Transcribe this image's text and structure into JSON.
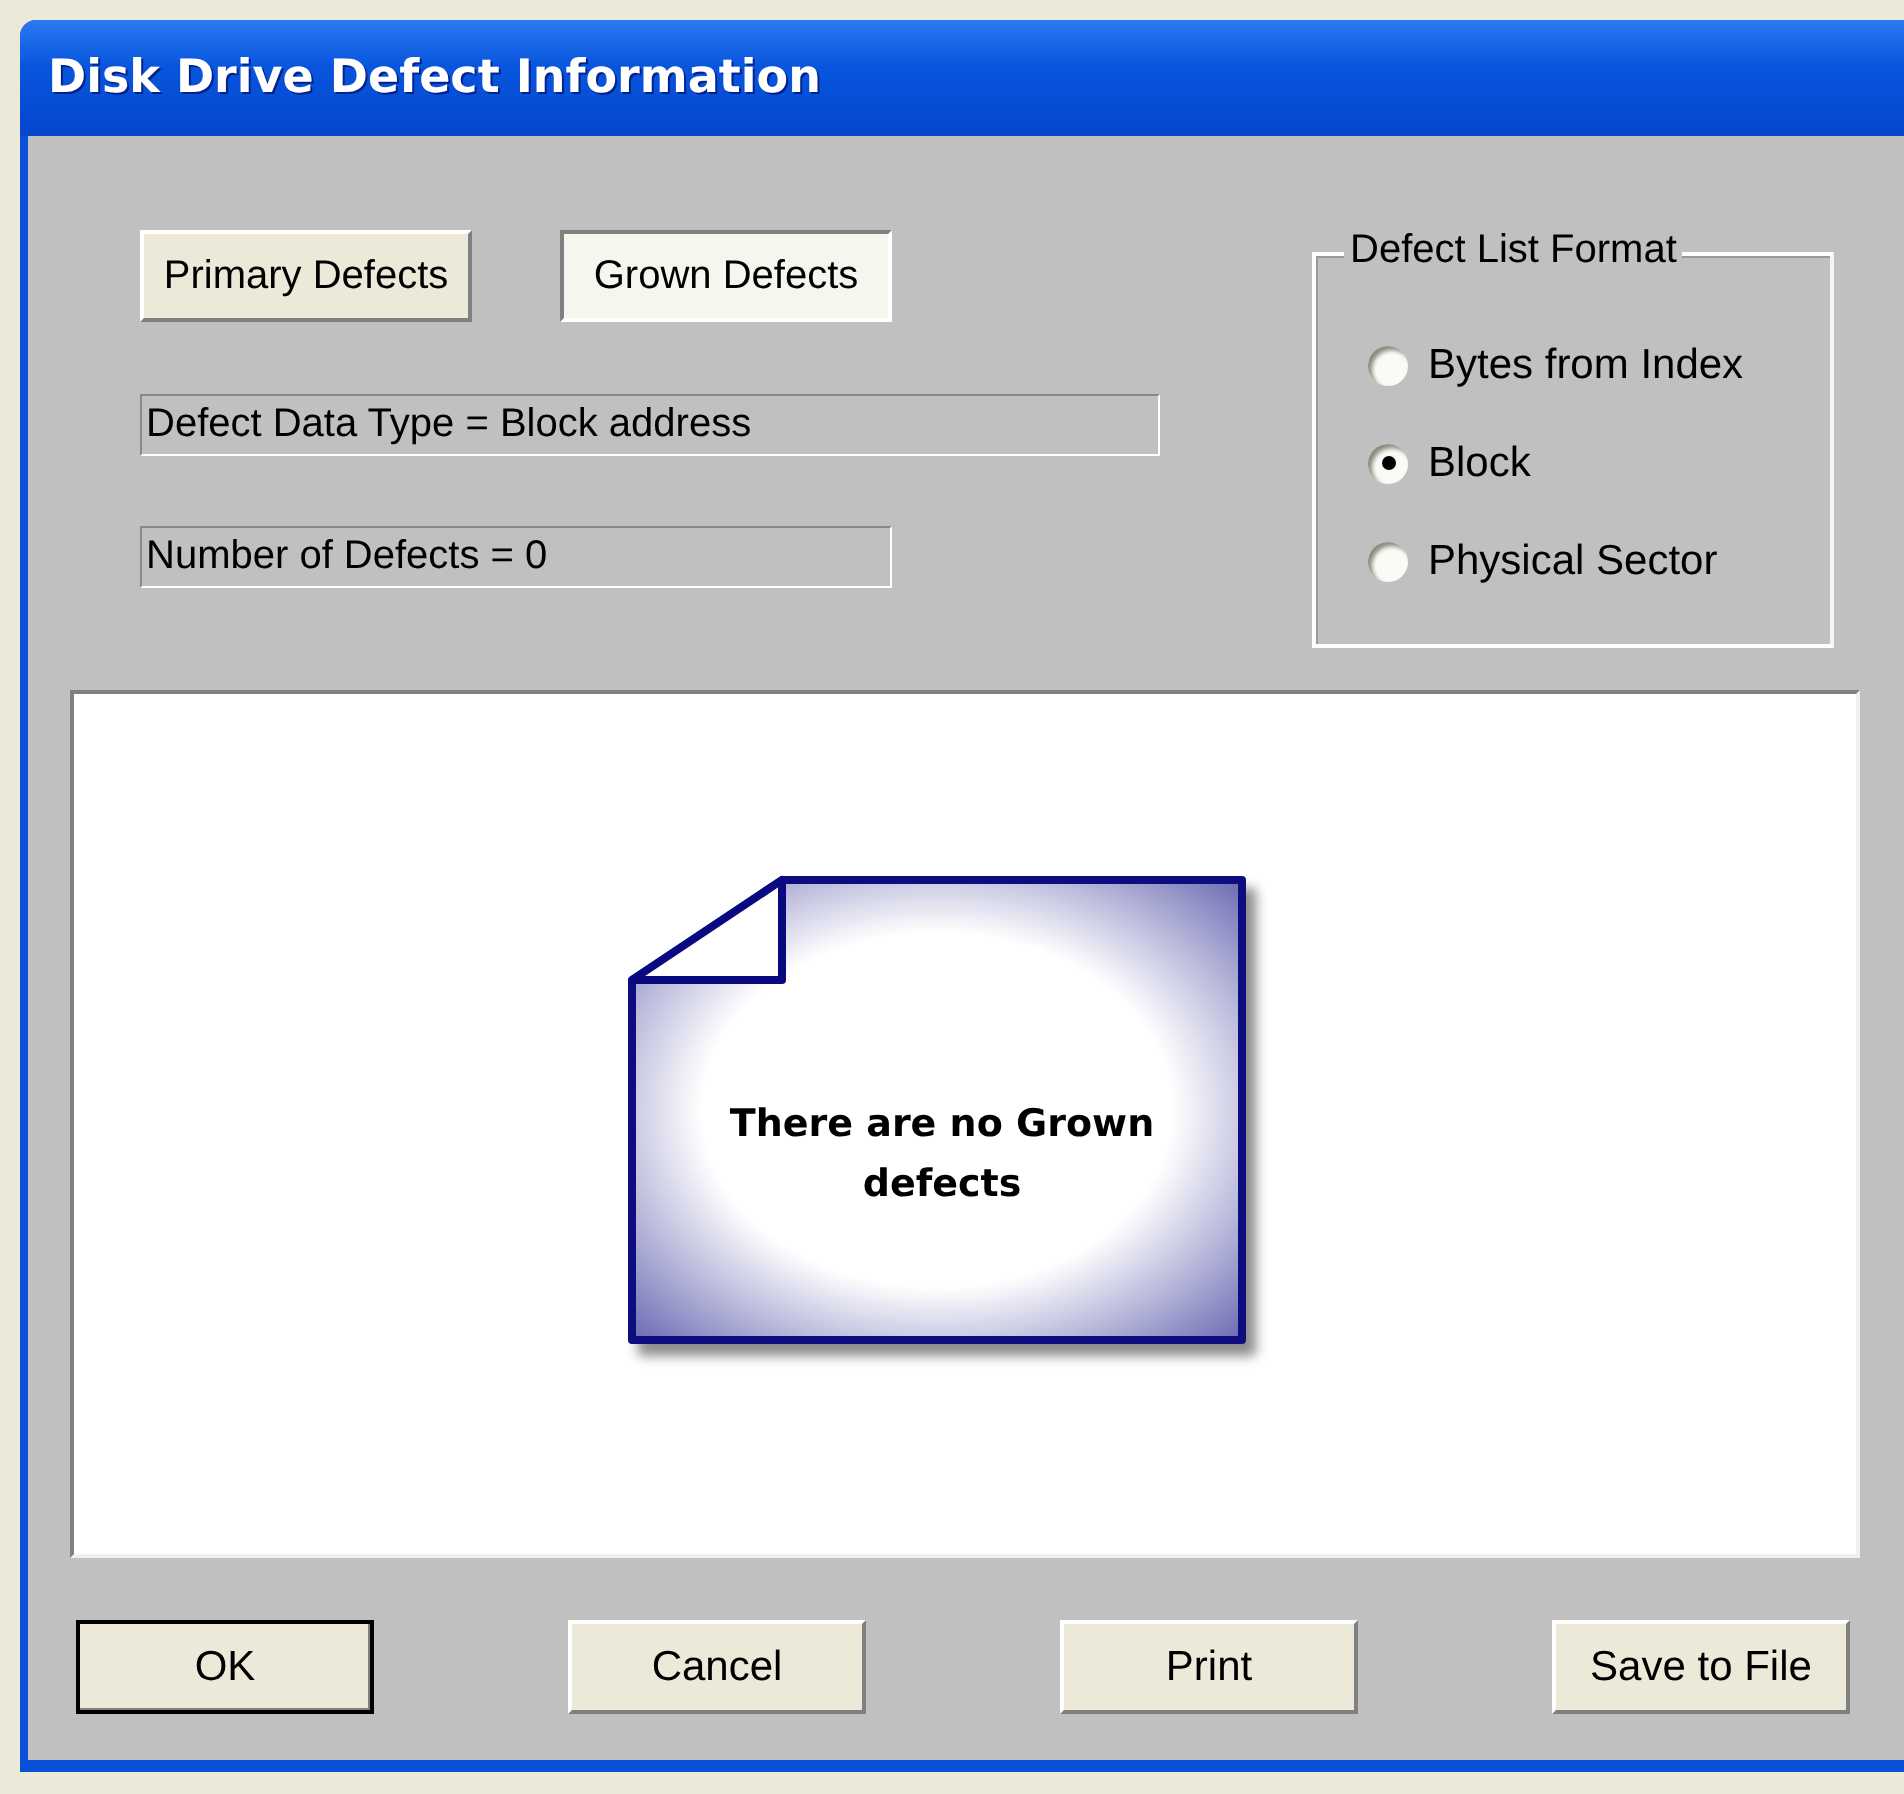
{
  "window": {
    "title": "Disk Drive Defect Information"
  },
  "defect_tabs": [
    {
      "label": "Primary Defects",
      "selected": false
    },
    {
      "label": "Grown Defects",
      "selected": true
    }
  ],
  "info_fields": [
    {
      "value": "Defect Data Type = Block address"
    },
    {
      "value": "Number of Defects = 0"
    }
  ],
  "defect_list_format": {
    "title": "Defect List Format",
    "options": [
      {
        "label": "Bytes from Index",
        "selected": false
      },
      {
        "label": "Block",
        "selected": true
      },
      {
        "label": "Physical Sector",
        "selected": false
      }
    ]
  },
  "message": {
    "text": "There are no Grown defects"
  },
  "buttons": [
    {
      "label": "OK",
      "default": true
    },
    {
      "label": "Cancel",
      "default": false
    },
    {
      "label": "Print",
      "default": false
    },
    {
      "label": "Save to File",
      "default": false
    }
  ]
}
